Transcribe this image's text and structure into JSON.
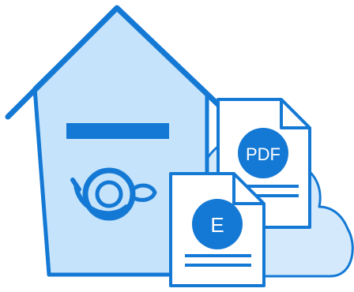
{
  "illustration": {
    "pdf_badge_text": "PDF",
    "e_badge_text": "E",
    "icons": [
      "mailbox-house-icon",
      "post-horn-icon",
      "cloud-icon",
      "pdf-document-icon",
      "e-document-icon"
    ]
  },
  "colors": {
    "primary_blue": "#1479d4",
    "light_blue_fill": "#c5e3fb",
    "cloud_fill": "#d4eafc",
    "page_white": "#ffffff"
  }
}
